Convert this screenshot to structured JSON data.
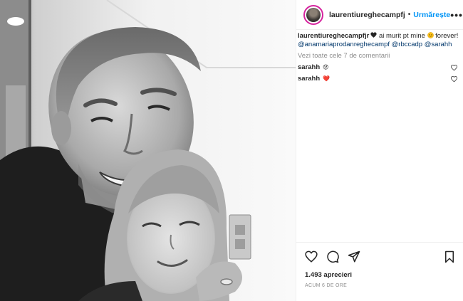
{
  "post": {
    "username": "laurentiureghecampfj",
    "separator": "•",
    "follow_label": "Urmărește",
    "more_label": "•••"
  },
  "caption": {
    "author": "laurentiureghecampfjr",
    "text_before": " ai murit pt mine ",
    "text_after": " forever!",
    "mentions": "@anamariaprodanreghecampf @rbccadp @sarahh"
  },
  "view_all_label": "Vezi toate cele 7 de comentarii",
  "comments": [
    {
      "user": "sarahh",
      "emoji": "😟"
    },
    {
      "user": "sarahh",
      "emoji": "❤️"
    }
  ],
  "likes_label": "1.493 aprecieri",
  "time_label": "ACUM 6 DE ORE",
  "icons": {
    "like": "heart-outline-icon",
    "comment": "comment-bubble-icon",
    "share": "paper-plane-icon",
    "save": "bookmark-icon"
  },
  "colors": {
    "follow": "#0095f6",
    "mention": "#00376b",
    "heart": "#ed4956"
  }
}
